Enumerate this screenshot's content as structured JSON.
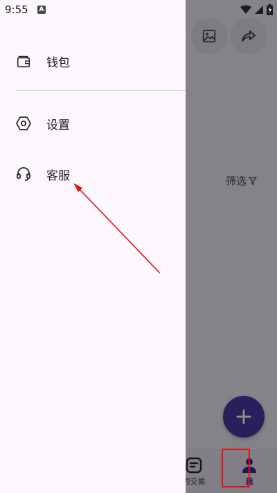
{
  "status_bar": {
    "time": "9:55",
    "notification_badge": "A",
    "icons": [
      "wifi-icon",
      "signal-icon",
      "battery-icon"
    ]
  },
  "drawer": {
    "items": [
      {
        "label": "钱包",
        "icon": "wallet-icon"
      },
      {
        "label": "设置",
        "icon": "settings-hexagon-icon"
      },
      {
        "label": "客服",
        "icon": "headset-icon"
      }
    ]
  },
  "background_app": {
    "top_buttons": [
      "image-icon",
      "share-icon"
    ],
    "filter_label": "筛选",
    "fab_icon": "plus-icon",
    "bottom_nav": [
      {
        "label": "的交易",
        "icon": "trades-icon"
      },
      {
        "label": "我",
        "icon": "person-icon",
        "active": true
      }
    ]
  },
  "colors": {
    "drawer_bg": "#fdf8fd",
    "fab": "#4b3aa8",
    "active_nav": "#3a2a8c",
    "annotation": "#e01010"
  }
}
